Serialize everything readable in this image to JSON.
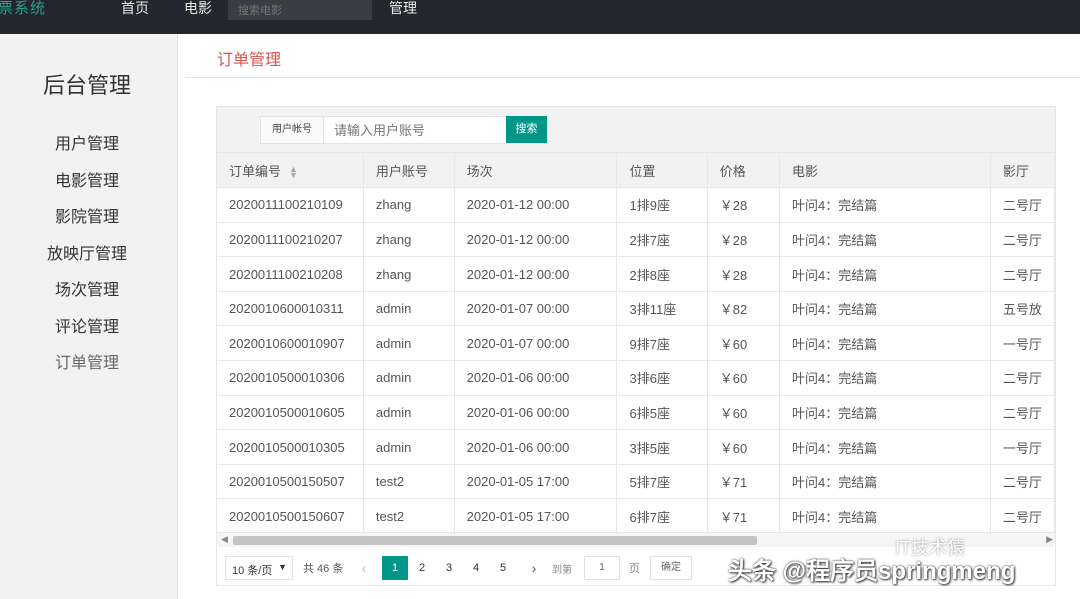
{
  "topnav": {
    "brand": "票系统",
    "home": "首页",
    "movies": "电影",
    "search_placeholder": "搜索电影",
    "manage": "管理"
  },
  "sidebar": {
    "title": "后台管理",
    "items": [
      {
        "label": "用户管理"
      },
      {
        "label": "电影管理"
      },
      {
        "label": "影院管理"
      },
      {
        "label": "放映厅管理"
      },
      {
        "label": "场次管理"
      },
      {
        "label": "评论管理"
      },
      {
        "label": "订单管理"
      }
    ]
  },
  "main": {
    "title": "订单管理",
    "search": {
      "label": "用户帐号",
      "placeholder": "请输入用户账号",
      "button": "搜索"
    },
    "table": {
      "columns": [
        "订单编号",
        "用户账号",
        "场次",
        "位置",
        "价格",
        "电影",
        "影厅"
      ],
      "rows": [
        [
          "2020011100210109",
          "zhang",
          "2020-01-12 00:00",
          "1排9座",
          "￥28",
          "叶问4：完结篇",
          "二号厅"
        ],
        [
          "2020011100210207",
          "zhang",
          "2020-01-12 00:00",
          "2排7座",
          "￥28",
          "叶问4：完结篇",
          "二号厅"
        ],
        [
          "2020011100210208",
          "zhang",
          "2020-01-12 00:00",
          "2排8座",
          "￥28",
          "叶问4：完结篇",
          "二号厅"
        ],
        [
          "2020010600010311",
          "admin",
          "2020-01-07 00:00",
          "3排11座",
          "￥82",
          "叶问4：完结篇",
          "五号放"
        ],
        [
          "2020010600010907",
          "admin",
          "2020-01-07 00:00",
          "9排7座",
          "￥60",
          "叶问4：完结篇",
          "一号厅"
        ],
        [
          "2020010500010306",
          "admin",
          "2020-01-06 00:00",
          "3排6座",
          "￥60",
          "叶问4：完结篇",
          "二号厅"
        ],
        [
          "2020010500010605",
          "admin",
          "2020-01-06 00:00",
          "6排5座",
          "￥60",
          "叶问4：完结篇",
          "二号厅"
        ],
        [
          "2020010500010305",
          "admin",
          "2020-01-06 00:00",
          "3排5座",
          "￥60",
          "叶问4：完结篇",
          "一号厅"
        ],
        [
          "2020010500150507",
          "test2",
          "2020-01-05 17:00",
          "5排7座",
          "￥71",
          "叶问4：完结篇",
          "二号厅"
        ],
        [
          "2020010500150607",
          "test2",
          "2020-01-05 17:00",
          "6排7座",
          "￥71",
          "叶问4：完结篇",
          "二号厅"
        ]
      ]
    },
    "pager": {
      "page_size": "10 条/页",
      "total": "共 46 条",
      "pages": [
        "1",
        "2",
        "3",
        "4",
        "5"
      ],
      "current": "1",
      "goto_label": "到第",
      "goto_value": "1",
      "page_unit": "页",
      "confirm": "确定"
    }
  },
  "watermark": {
    "text": "头条 @程序员springmeng",
    "wechat": "IT技术猿"
  },
  "colors": {
    "accent": "#009688",
    "title_red": "#d9534f",
    "topbar": "#23262e"
  }
}
